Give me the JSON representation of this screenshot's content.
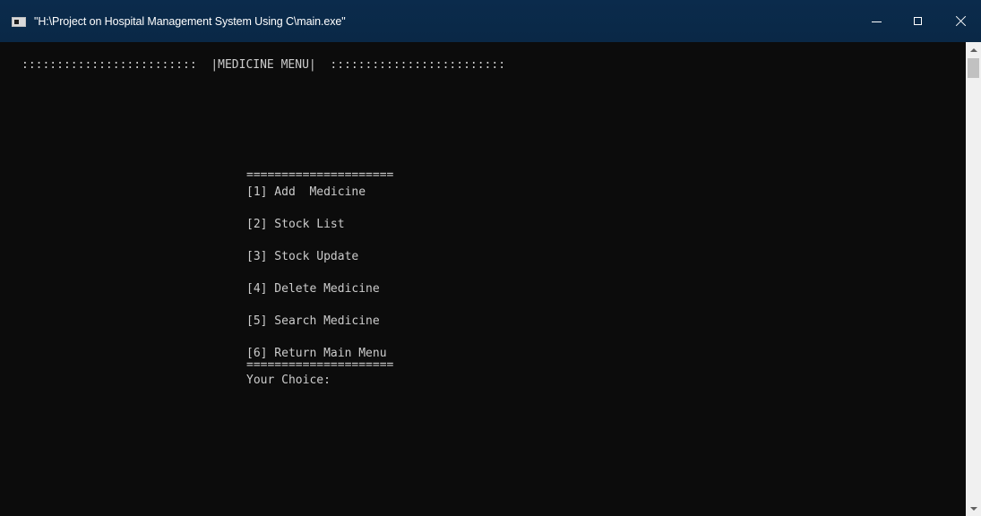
{
  "window": {
    "title": "\"H:\\Project on Hospital Management System Using C\\main.exe\""
  },
  "console": {
    "header": ":::::::::::::::::::::::::  |MEDICINE MENU|  :::::::::::::::::::::::::",
    "divider_top": "=====================",
    "options": [
      "[1] Add  Medicine",
      "[2] Stock List",
      "[3] Stock Update",
      "[4] Delete Medicine",
      "[5] Search Medicine",
      "[6] Return Main Menu"
    ],
    "divider_bottom": "=====================",
    "prompt": "Your Choice:"
  },
  "colors": {
    "titlebar": "#0a2846",
    "console_bg": "#0c0c0c",
    "console_text": "#cccccc",
    "scrollbar": "#f0f0f0"
  },
  "icons": {
    "app": "console-app-icon",
    "minimize": "minimize-icon",
    "maximize": "maximize-icon",
    "close": "close-icon",
    "scroll_up": "chevron-up-icon",
    "scroll_down": "chevron-down-icon"
  }
}
